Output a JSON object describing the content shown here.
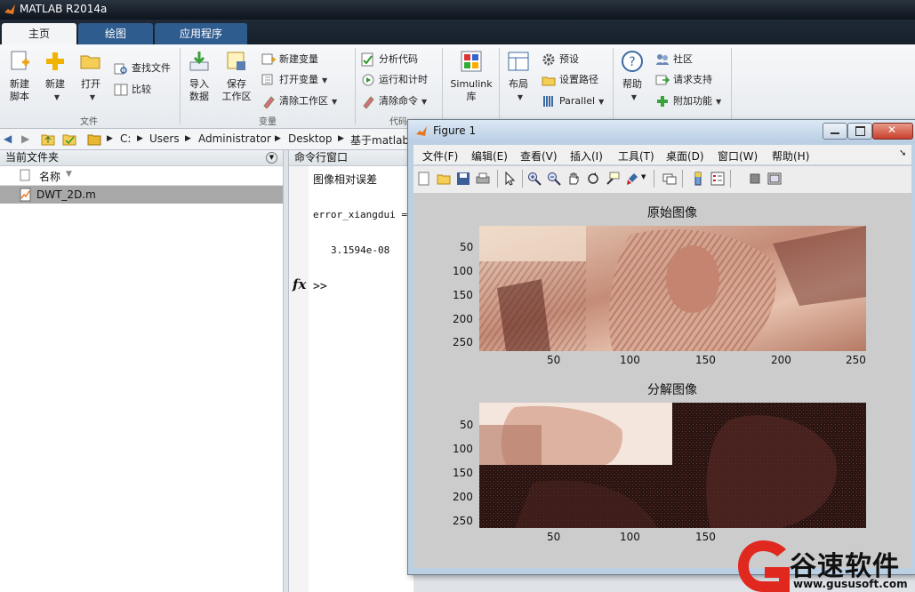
{
  "app": {
    "title": "MATLAB R2014a",
    "tabs": [
      "主页",
      "绘图",
      "应用程序"
    ]
  },
  "ribbon": {
    "groups": {
      "file": "文件",
      "variable": "变量",
      "code": "代码"
    },
    "new_script": [
      "新建",
      "脚本"
    ],
    "new": "新建",
    "open": "打开",
    "find_files": "查找文件",
    "compare": "比较",
    "import_data": [
      "导入",
      "数据"
    ],
    "save_workspace": [
      "保存",
      "工作区"
    ],
    "new_variable": "新建变量",
    "open_variable": "打开变量",
    "clear_workspace": "清除工作区",
    "analyze_code": "分析代码",
    "run_and_time": "运行和计时",
    "clear_commands": "清除命令",
    "simulink": [
      "Simulink",
      "库"
    ],
    "layout": "布局",
    "preferences": "预设",
    "set_path": "设置路径",
    "parallel": "Parallel",
    "help": "帮助",
    "community": "社区",
    "request_support": "请求支持",
    "add_ons": "附加功能"
  },
  "address": {
    "parts": [
      "C:",
      "Users",
      "Administrator",
      "Desktop",
      "基于matlab"
    ]
  },
  "current_folder": {
    "header": "当前文件夹",
    "column_name": "名称",
    "files": [
      "DWT_2D.m"
    ]
  },
  "command_window": {
    "header": "命令行窗口",
    "line1": "图像相对误差",
    "line2": "error_xiangdui =",
    "line3": "3.1594e-08",
    "prompt": ">>",
    "fx": "fx"
  },
  "figure": {
    "title": "Figure 1",
    "menu": [
      "文件(F)",
      "编辑(E)",
      "查看(V)",
      "插入(I)",
      "工具(T)",
      "桌面(D)",
      "窗口(W)",
      "帮助(H)"
    ],
    "plot1_title": "原始图像",
    "plot2_title": "分解图像",
    "y_ticks": [
      "50",
      "100",
      "150",
      "200",
      "250"
    ],
    "x_ticks": [
      "50",
      "100",
      "150",
      "200",
      "250"
    ]
  },
  "watermark": {
    "name": "谷速软件",
    "url": "www.gususoft.com"
  },
  "colors": {
    "matlab_dark": "#1a2430",
    "tab_blue": "#2f5c8f",
    "image_tone": "#c99a88",
    "image_dark": "#2a1412",
    "watermark_red": "#e0281f"
  }
}
